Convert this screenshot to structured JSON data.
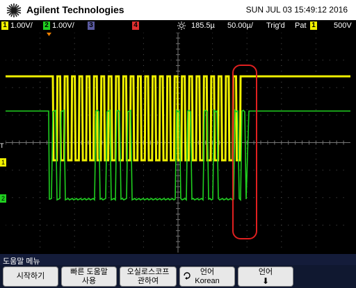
{
  "brand": "Agilent Technologies",
  "datetime": "SUN JUL 03 15:49:12 2016",
  "status": {
    "ch1_num": "1",
    "ch1_scale": "1.00V/",
    "ch2_num": "2",
    "ch2_scale": "1.00V/",
    "ch3_num": "3",
    "ch4_num": "4",
    "timebase": "185.5µ",
    "timediv": "50.00µ/",
    "trig_state": "Trig'd",
    "trig_mode": "Pat",
    "trig_ch": "1",
    "trig_level": "500V"
  },
  "markers": {
    "t": "T",
    "ch1": "1",
    "ch2": "2"
  },
  "menu": {
    "title": "도움말 메뉴",
    "keys": [
      {
        "line1": "시작하기",
        "line2": ""
      },
      {
        "line1": "빠른 도움말",
        "line2": "사용"
      },
      {
        "line1": "오실로스코프",
        "line2": "관하여"
      },
      {
        "line1": "언어",
        "line2": "Korean"
      },
      {
        "line1": "언어",
        "line2": "⬇"
      }
    ]
  },
  "colors": {
    "ch1": "#f0f000",
    "ch2": "#20d020",
    "ch3": "#5a5aa0",
    "ch4": "#e03030",
    "annotation": "#e02020",
    "grid": "#555555"
  }
}
